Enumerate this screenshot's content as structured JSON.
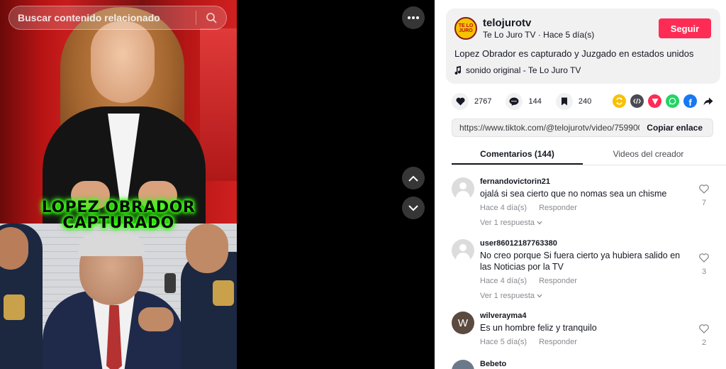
{
  "search": {
    "placeholder": "Buscar contenido relacionado"
  },
  "video": {
    "caption_line1": "LOPEZ OBRADOR",
    "caption_line2": "CAPTURADO"
  },
  "author": {
    "username": "telojurotv",
    "display_name": "Te Lo Juro TV",
    "separator": " · ",
    "posted": "Hace 5 día(s)",
    "avatar_text_1": "TE LO",
    "avatar_text_2": "JURO",
    "follow_label": "Seguir"
  },
  "post": {
    "description": "Lopez Obrador es capturado y Juzgado en estados unidos",
    "sound": "sonido original - Te Lo Juro TV"
  },
  "stats": {
    "likes": "2767",
    "comments": "144",
    "saves": "240"
  },
  "link": {
    "url": "https://www.tiktok.com/@telojurotv/video/759900...",
    "copy_label": "Copiar enlace"
  },
  "tabs": [
    {
      "label": "Comentarios (144)"
    },
    {
      "label": "Videos del creador"
    }
  ],
  "comments": [
    {
      "user": "fernandovictorin21",
      "text": "ojalá si sea cierto que no nomas sea un chisme",
      "time": "Hace 4 día(s)",
      "reply": "Responder",
      "likes": "7",
      "replies": "Ver 1 respuesta",
      "avatar": ""
    },
    {
      "user": "user86012187763380",
      "text": "No creo porque Si fuera cierto ya hubiera salido en las Noticias por la TV",
      "time": "Hace 4 día(s)",
      "reply": "Responder",
      "likes": "3",
      "replies": "Ver 1 respuesta",
      "avatar": ""
    },
    {
      "user": "wilverayma4",
      "text": "Es un hombre feliz y tranquilo",
      "time": "Hace 5 día(s)",
      "reply": "Responder",
      "likes": "2",
      "replies": "",
      "avatar": "W"
    },
    {
      "user": "Bebeto",
      "text": "",
      "time": "",
      "reply": "",
      "likes": "",
      "replies": "",
      "avatar": ""
    }
  ],
  "colors": {
    "accent": "#fe2c55",
    "text": "#161823",
    "muted": "#8a8b91",
    "caption_glow": "#39ff14"
  },
  "icons": {
    "search": "search-icon",
    "more": "more-icon",
    "up": "chevron-up-icon",
    "down": "chevron-down-icon",
    "like": "heart-icon",
    "comment": "comment-icon",
    "save": "bookmark-icon",
    "music": "music-note-icon"
  }
}
